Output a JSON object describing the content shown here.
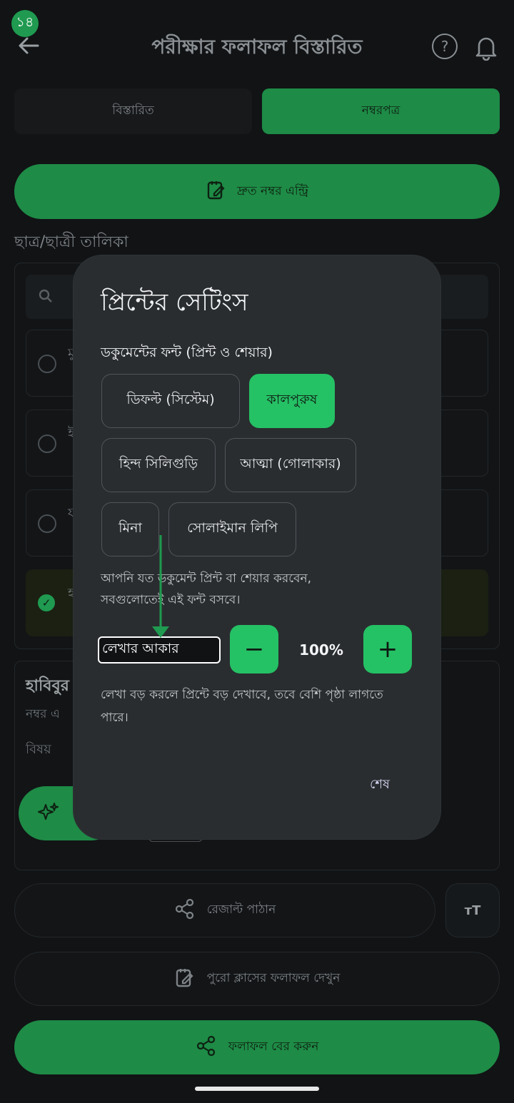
{
  "status": {
    "badge": "১৪"
  },
  "header": {
    "title": "পরীক্ষার ফলাফল বিস্তারিত",
    "help": "?"
  },
  "tabs": {
    "details": "বিস্তারিত",
    "marksheet": "নম্বরপত্র"
  },
  "quick_entry": {
    "label": "দ্রুত নম্বর এন্ট্রি"
  },
  "list": {
    "section_label": "ছাত্র/ছাত্রী তালিকা",
    "rows": [
      {
        "initial": "মু"
      },
      {
        "initial": "ই"
      },
      {
        "initial": "য"
      },
      {
        "initial": "হ"
      }
    ]
  },
  "detail": {
    "title": "হাবিবুর",
    "subtitle": "নম্বর এ",
    "subject": "বিষয়"
  },
  "bottom": {
    "send_label": "রেজাল্ট পাঠান",
    "fontsize_icon": "ᴛT",
    "class_result_label": "পুরো ক্লাসের ফলাফল দেখুন",
    "export_label": "ফলাফল বের করুন"
  },
  "dialog": {
    "title": "প্রিন্টের সেটিংস",
    "font_label": "ডকুমেন্টের ফন্ট (প্রিন্ট ও শেয়ার)",
    "fonts": [
      "ডিফল্ট (সিস্টেম)",
      "কালপুরুষ",
      "হিন্দ সিলিগুড়ি",
      "আত্মা (গোলাকার)",
      "মিনা",
      "সোলাইমান লিপি"
    ],
    "selected_font": "কালপুরুষ",
    "font_note": "আপনি যত ডকুমেন্ট প্রিন্ট বা শেয়ার করবেন, সবগুলোতেই এই ফন্ট বসবে।",
    "size_label": "লেখার আকার",
    "size_minus": "−",
    "size_value": "100%",
    "size_plus": "+",
    "size_note": "লেখা বড় করলে প্রিন্টে বড় দেখাবে, তবে বেশি পৃষ্ঠা লাগতে পারে।",
    "done_label": "শেষ"
  },
  "colors": {
    "accent": "#25c165",
    "accent_dim": "#1e8b46",
    "dialog_bg": "#2a2d30",
    "page_bg": "#111315"
  }
}
